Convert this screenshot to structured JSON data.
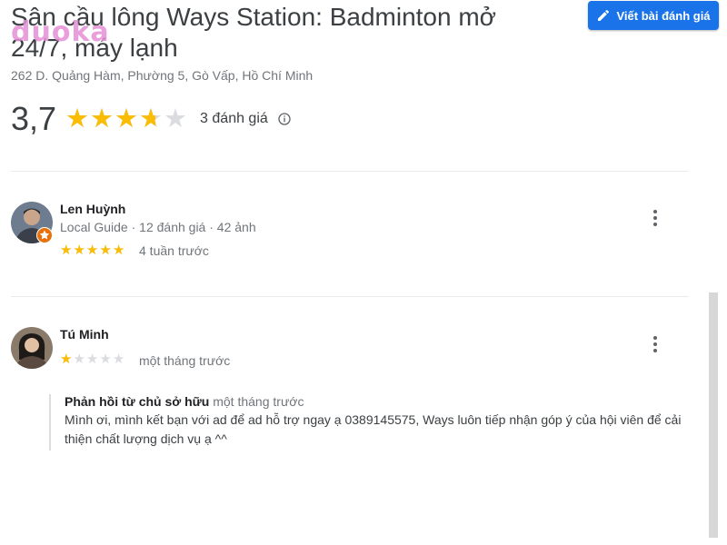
{
  "place": {
    "title": "Sân cầu lông Ways Station: Badminton mở 24/7, máy lạnh",
    "address": "262 D. Quảng Hàm, Phường 5, Gò Vấp, Hồ Chí Minh",
    "rating_text": "3,7",
    "rating": 3.7,
    "review_count": "3 đánh giá"
  },
  "actions": {
    "write_review": "Viết bài đánh giá"
  },
  "watermark": "duoka",
  "reviews": [
    {
      "name": "Len Huỳnh",
      "meta": "Local Guide · 12 đánh giá · 42 ảnh",
      "stars": 5,
      "date": "4 tuần trước"
    },
    {
      "name": "Tú Minh",
      "stars": 1,
      "date": "một tháng trước",
      "owner_reply": {
        "label": "Phản hồi từ chủ sở hữu",
        "date": "một tháng trước",
        "text": "Mình ơi, mình kết bạn với ad để ad hỗ trợ ngay ạ 0389145575, Ways luôn tiếp nhận góp ý của hội viên để cải thiện chất lượng dịch vụ ạ ^^"
      }
    }
  ],
  "colors": {
    "accent": "#1a73e8",
    "star": "#fbbc04",
    "star_empty": "#dadce0",
    "badge": "#e8710a"
  },
  "icons": [
    "pencil-icon",
    "info-icon",
    "more-vert-icon",
    "local-guide-badge-icon"
  ]
}
